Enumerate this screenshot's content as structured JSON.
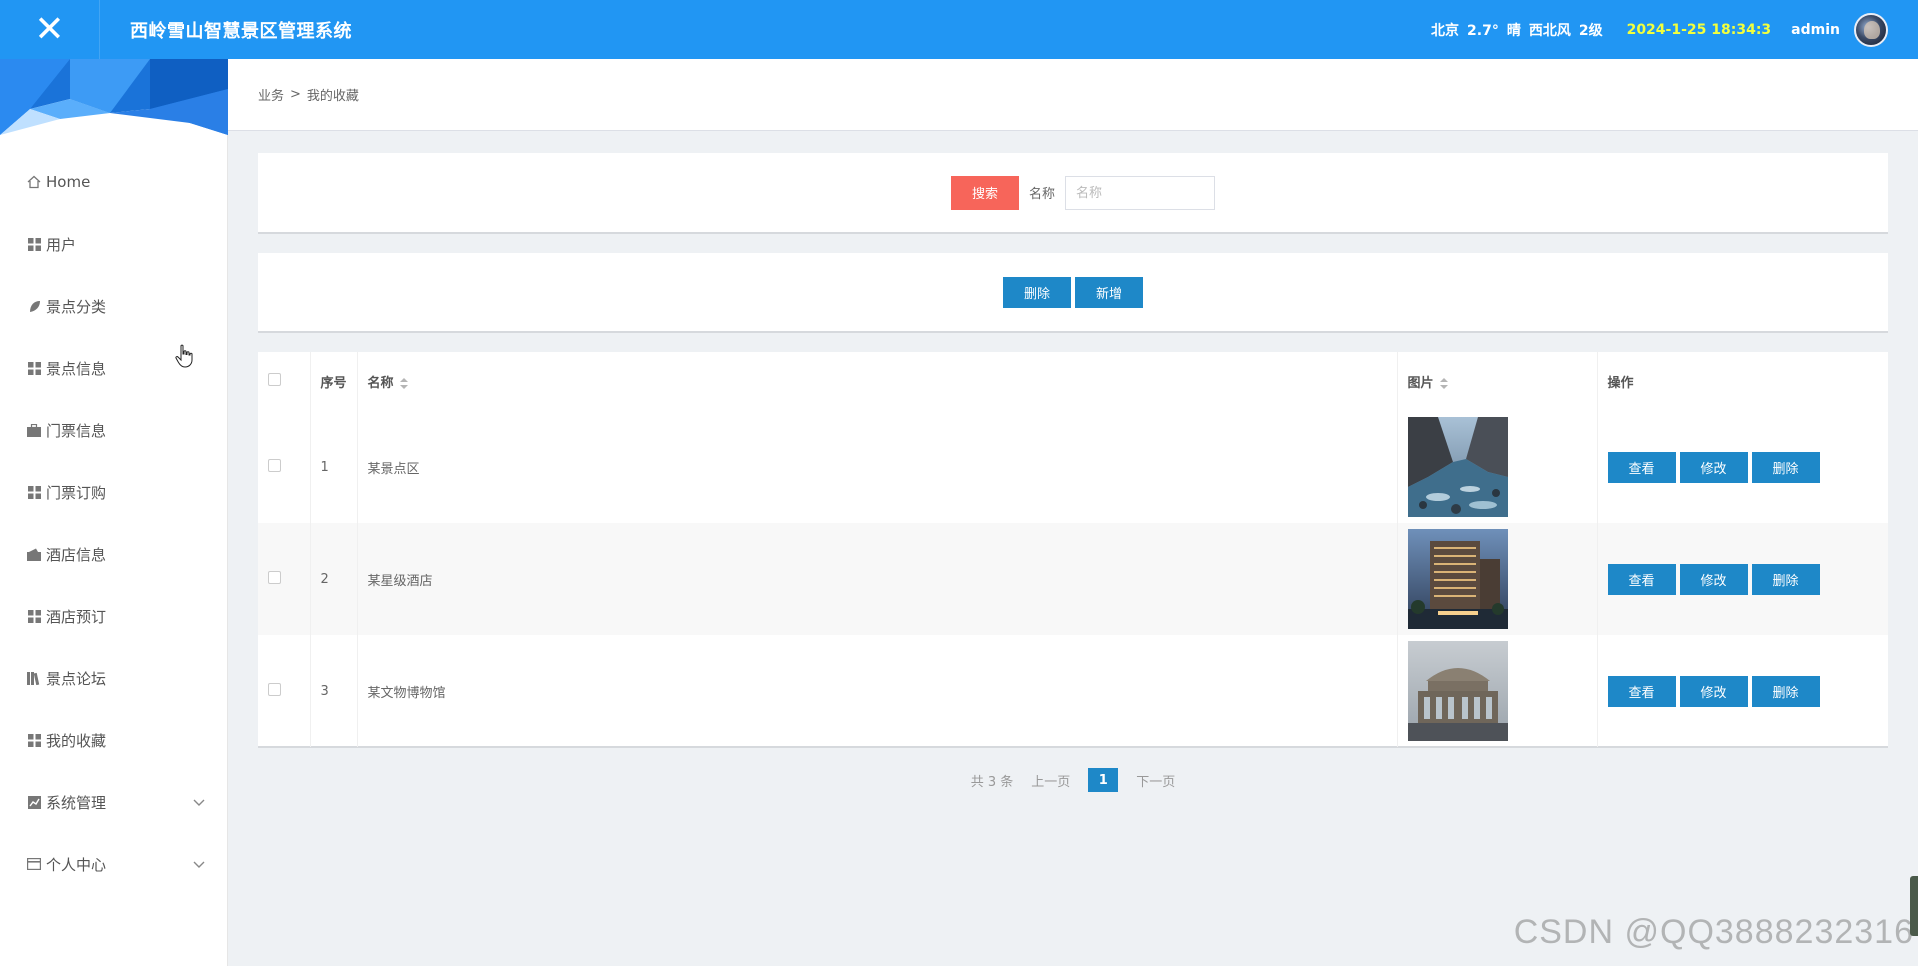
{
  "header": {
    "close_glyph": "✕",
    "title": "西岭雪山智慧景区管理系统",
    "weather": {
      "city": "北京",
      "temp": "2.7°",
      "condition": "晴",
      "wind": "西北风",
      "level": "2级"
    },
    "datetime": "2024-1-25 18:34:3",
    "user": "admin"
  },
  "sidebar": {
    "items": [
      {
        "label": "Home",
        "icon": "home-icon"
      },
      {
        "label": "用户",
        "icon": "grid-icon"
      },
      {
        "label": "景点分类",
        "icon": "leaf-icon"
      },
      {
        "label": "景点信息",
        "icon": "grid-icon"
      },
      {
        "label": "门票信息",
        "icon": "briefcase-icon"
      },
      {
        "label": "门票订购",
        "icon": "grid-icon"
      },
      {
        "label": "酒店信息",
        "icon": "wallet-icon"
      },
      {
        "label": "酒店预订",
        "icon": "grid-icon"
      },
      {
        "label": "景点论坛",
        "icon": "book-icon"
      },
      {
        "label": "我的收藏",
        "icon": "grid-icon"
      },
      {
        "label": "系统管理",
        "icon": "chart-icon",
        "expandable": true
      },
      {
        "label": "个人中心",
        "icon": "card-icon",
        "expandable": true
      }
    ]
  },
  "breadcrumb": {
    "parent": "业务",
    "separator": ">",
    "current": "我的收藏"
  },
  "search": {
    "button": "搜索",
    "label": "名称",
    "placeholder": "名称",
    "value": ""
  },
  "actions": {
    "delete": "删除",
    "add": "新增"
  },
  "table": {
    "headers": {
      "index": "序号",
      "name": "名称",
      "image": "图片",
      "ops": "操作"
    },
    "rows": [
      {
        "index": "1",
        "name": "某景点区",
        "image": "river-valley-photo"
      },
      {
        "index": "2",
        "name": "某星级酒店",
        "image": "hotel-building-photo"
      },
      {
        "index": "3",
        "name": "某文物博物馆",
        "image": "museum-building-photo"
      }
    ],
    "row_buttons": {
      "view": "查看",
      "edit": "修改",
      "delete": "删除"
    }
  },
  "pager": {
    "total": "共 3 条",
    "prev": "上一页",
    "current": "1",
    "next": "下一页"
  },
  "watermark": "CSDN @QQ3888232316",
  "colors": {
    "header": "#2196f3",
    "primary_button": "#1e88c8",
    "search_button": "#f7655a",
    "datetime": "#f2ff3d"
  }
}
